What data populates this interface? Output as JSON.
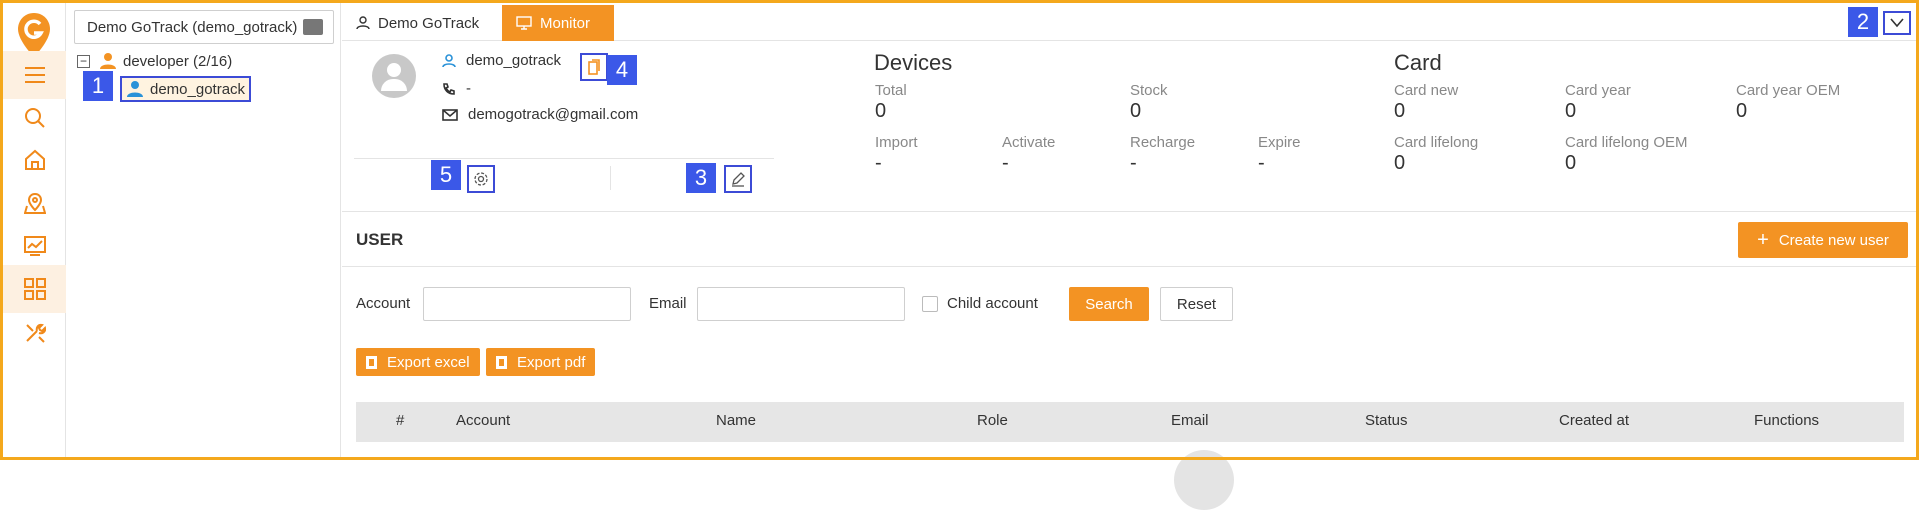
{
  "tree": {
    "account_select": "Demo GoTrack (demo_gotrack)",
    "root_label": "developer (2/16)",
    "child_label": "demo_gotrack"
  },
  "rail": {
    "icons": [
      "logo-icon",
      "menu-icon",
      "search-icon",
      "home-icon",
      "map-icon",
      "chart-icon",
      "apps-icon",
      "tools-icon"
    ],
    "active": "apps-icon"
  },
  "tabs": [
    {
      "label": "Demo GoTrack"
    },
    {
      "label": "Monitor"
    }
  ],
  "profile": {
    "username": "demo_gotrack",
    "phone": "-",
    "email": "demogotrack@gmail.com"
  },
  "devices": {
    "title": "Devices",
    "stats": [
      {
        "label": "Total",
        "value": "0"
      },
      {
        "label": "Stock",
        "value": "0"
      },
      {
        "label": "Import",
        "value": "-"
      },
      {
        "label": "Activate",
        "value": "-"
      },
      {
        "label": "Recharge",
        "value": "-"
      },
      {
        "label": "Expire",
        "value": "-"
      }
    ]
  },
  "card": {
    "title": "Card",
    "stats": [
      {
        "label": "Card new",
        "value": "0"
      },
      {
        "label": "Card year",
        "value": "0"
      },
      {
        "label": "Card year OEM",
        "value": "0"
      },
      {
        "label": "Card lifelong",
        "value": "0"
      },
      {
        "label": "Card lifelong OEM",
        "value": "0"
      }
    ]
  },
  "user": {
    "title": "USER",
    "create_label": "Create new user",
    "account_label": "Account",
    "account_value": "",
    "email_label": "Email",
    "email_value": "",
    "child_label": "Child account",
    "search_label": "Search",
    "reset_label": "Reset",
    "export_excel": "Export excel",
    "export_pdf": "Export pdf",
    "columns": [
      "#",
      "Account",
      "Name",
      "Role",
      "Email",
      "Status",
      "Created at",
      "Functions"
    ]
  },
  "annotations": [
    "1",
    "2",
    "3",
    "4",
    "5"
  ],
  "colors": {
    "accent": "#f39323",
    "tag": "#3b58e8",
    "frame": "#f4a81c"
  }
}
